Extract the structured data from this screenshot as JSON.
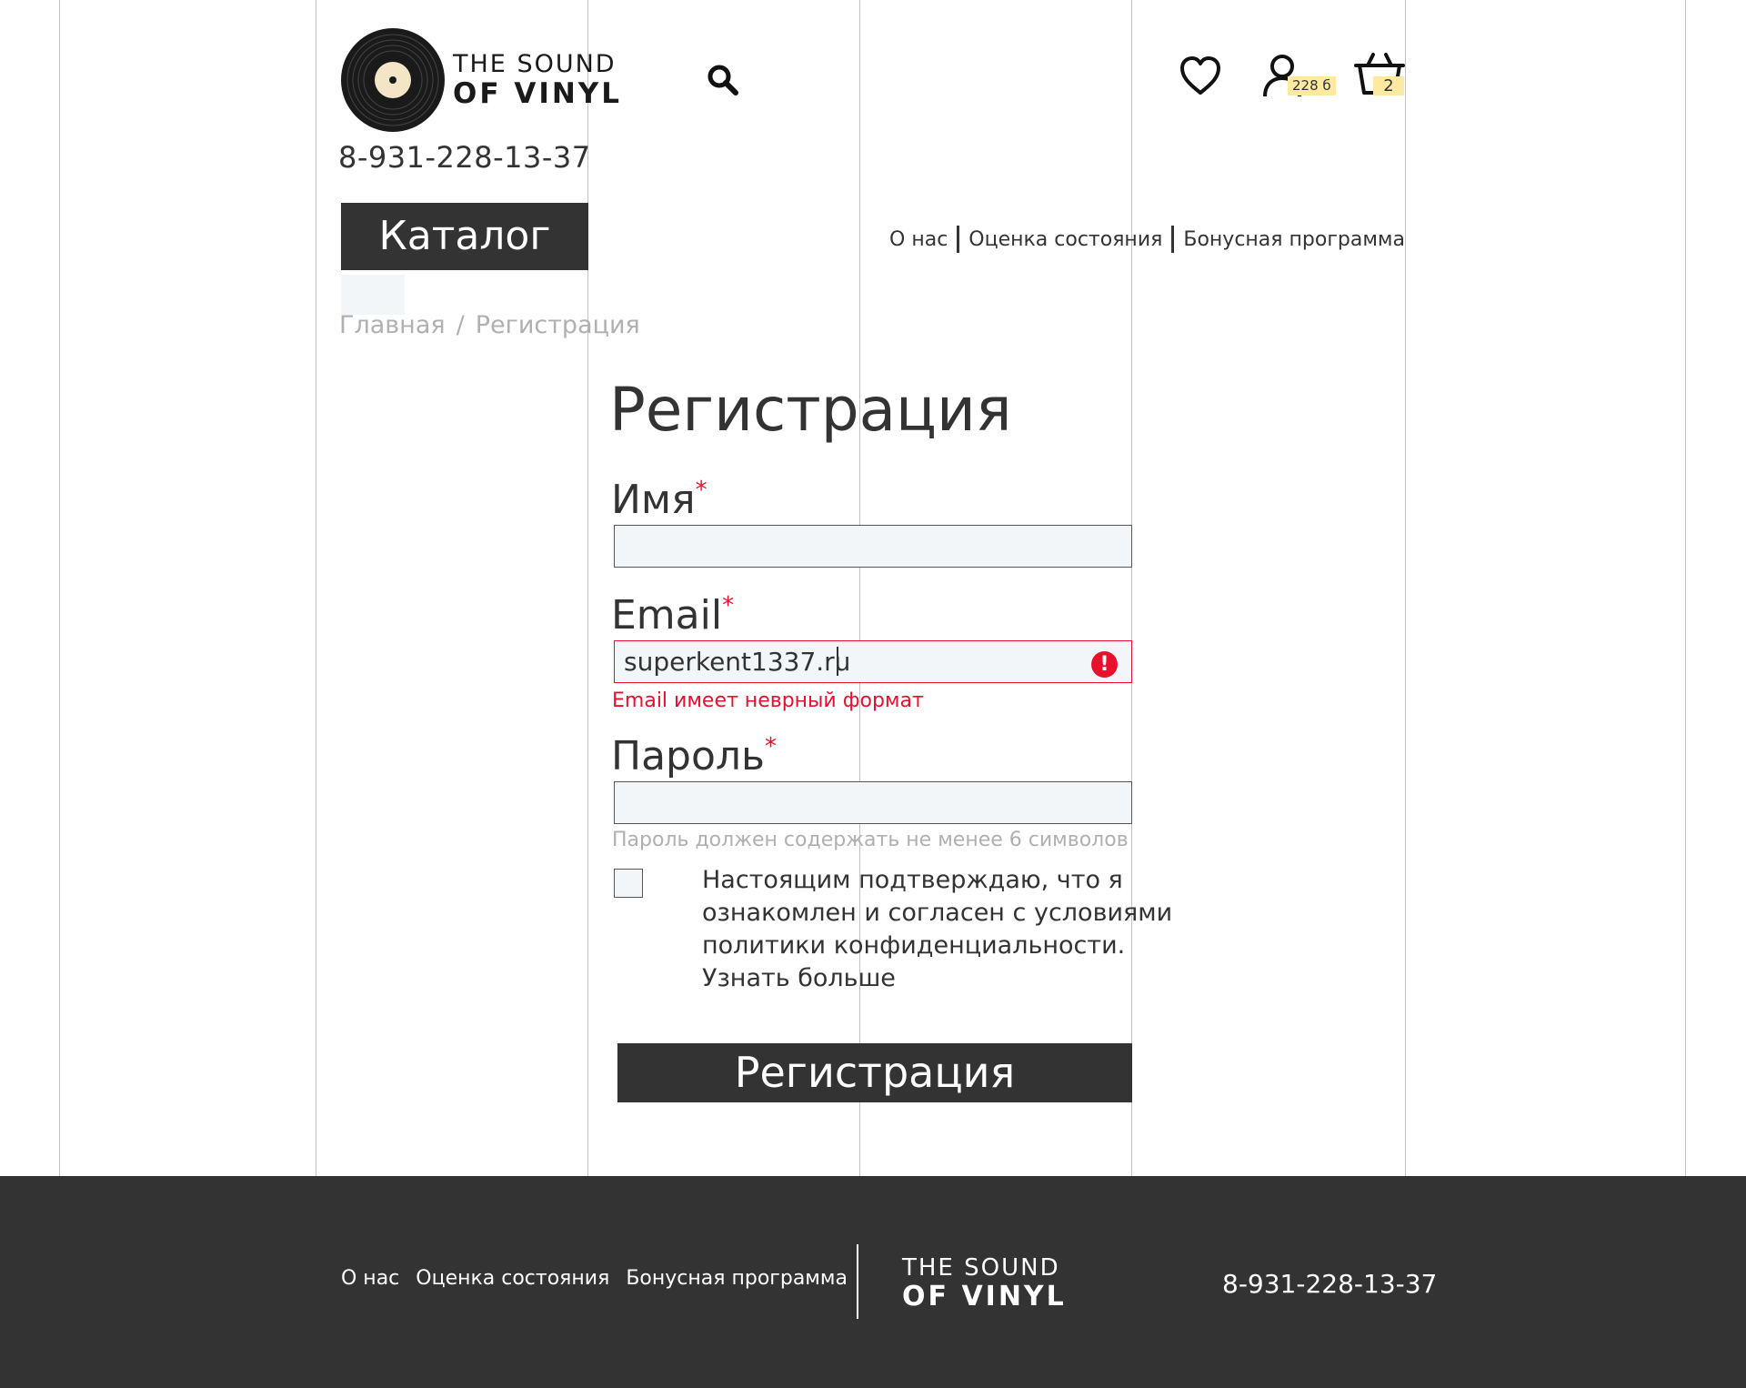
{
  "header": {
    "logo": {
      "line1": "THE SOUND",
      "line2": "OF VINYL"
    },
    "phone": "8-931-228-13-37",
    "user_badge": "228 б",
    "cart_badge": "2",
    "catalog_label": "Каталог",
    "nav": [
      {
        "label": "О нас"
      },
      {
        "label": "Оценка состояния"
      },
      {
        "label": "Бонусная программа"
      }
    ]
  },
  "breadcrumb": {
    "home": "Главная",
    "separator": "/",
    "current": "Регистрация"
  },
  "form": {
    "title": "Регистрация",
    "name_label": "Имя",
    "name_value": "",
    "email_label": "Email",
    "email_value": "superkent1337.ru",
    "email_error": "Email имеет неврный формат",
    "password_label": "Пароль",
    "password_value": "",
    "password_hint": "Пароль должен содержать не менее 6 символов",
    "required_mark": "*",
    "consent_text": "Настоящим подтверждаю, что я ознакомлен и согласен с условиями политики конфиденциальности. Узнать больше",
    "submit_label": "Регистрация",
    "error_icon_glyph": "!"
  },
  "footer": {
    "nav": [
      {
        "label": "О нас"
      },
      {
        "label": "Оценка состояния"
      },
      {
        "label": "Бонусная программа"
      }
    ],
    "logo": {
      "line1": "THE SOUND",
      "line2": "OF VINYL"
    },
    "phone": "8-931-228-13-37"
  },
  "colors": {
    "dark": "#333333",
    "error": "#e8112d",
    "input_bg": "#f3f6f8",
    "badge": "#fde9a0",
    "muted": "#b0b0b0"
  },
  "icons": [
    "vinyl-logo-icon",
    "search-icon",
    "heart-icon",
    "user-icon",
    "cart-icon",
    "error-icon"
  ]
}
